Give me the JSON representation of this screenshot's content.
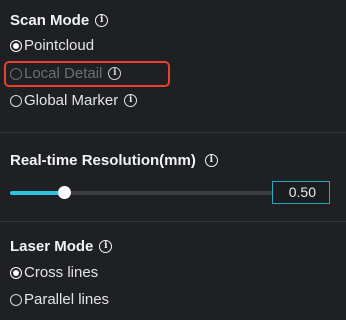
{
  "scan_mode": {
    "title": "Scan Mode",
    "options": [
      {
        "label": "Pointcloud",
        "selected": true,
        "disabled": false,
        "has_info": false
      },
      {
        "label": "Local Detail",
        "selected": false,
        "disabled": true,
        "has_info": true
      },
      {
        "label": "Global Marker",
        "selected": false,
        "disabled": false,
        "has_info": true
      }
    ]
  },
  "resolution": {
    "title": "Real-time Resolution(mm)",
    "value": "0.50",
    "slider_fraction": 0.2
  },
  "laser_mode": {
    "title": "Laser Mode",
    "options": [
      {
        "label": "Cross lines",
        "selected": true
      },
      {
        "label": "Parallel lines",
        "selected": false
      }
    ]
  },
  "colors": {
    "background": "#1f2023",
    "accent": "#2fc3e0",
    "highlight": "#e8412c",
    "disabled_text": "#6c6e72"
  },
  "icons": [
    "info-icon",
    "radio-selected-icon",
    "radio-unselected-icon"
  ]
}
